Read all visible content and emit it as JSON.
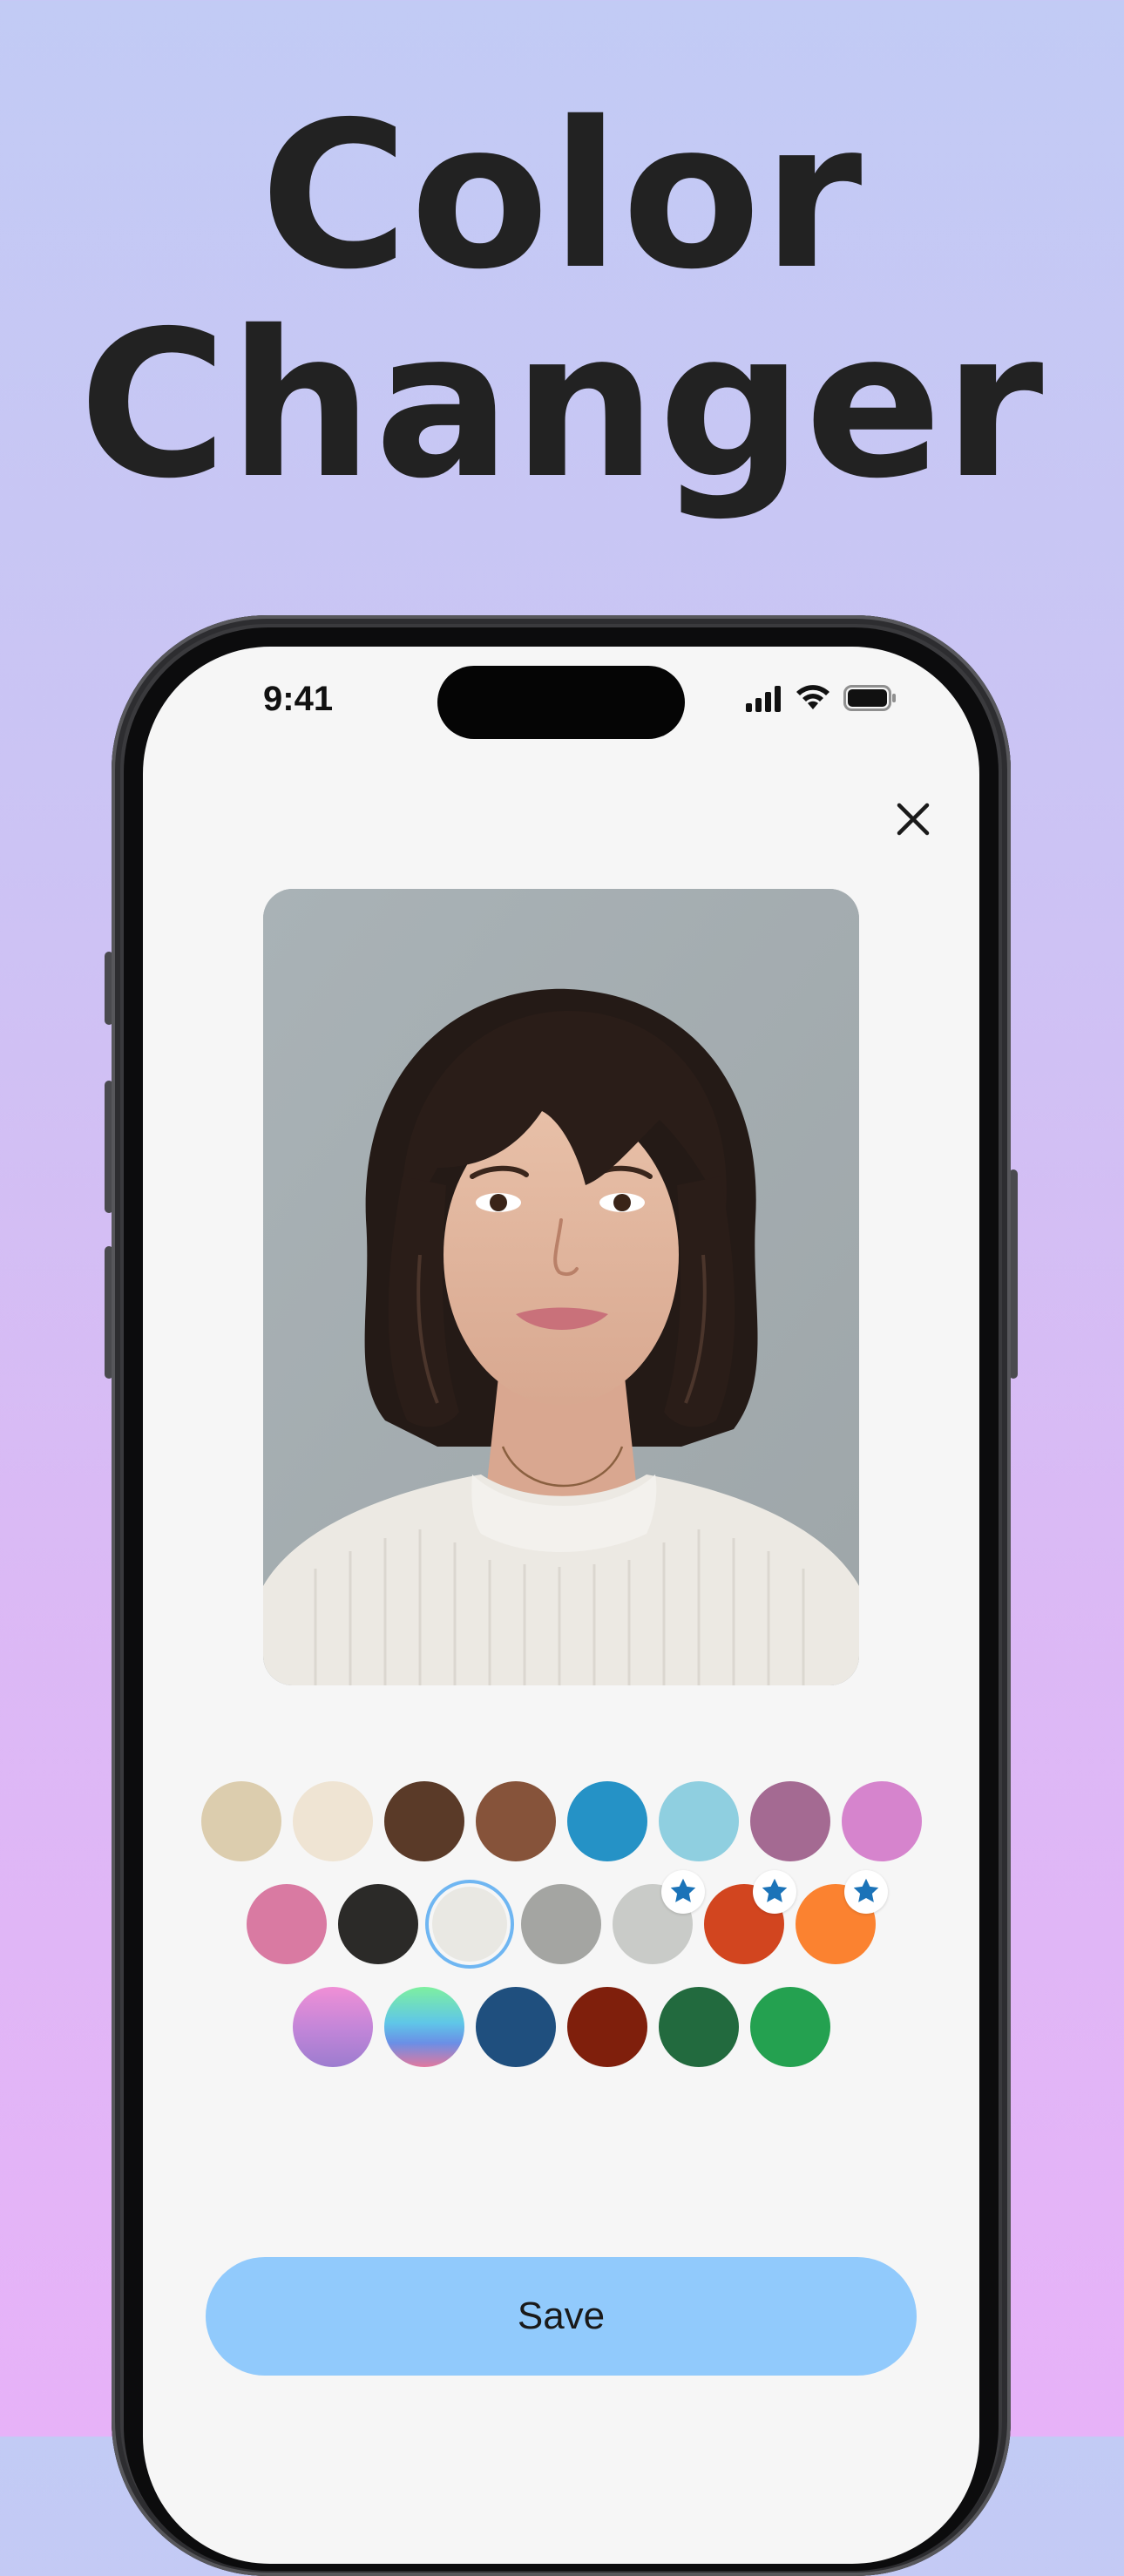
{
  "headline": {
    "line1": "Color",
    "line2": "Changer"
  },
  "status_bar": {
    "time": "9:41",
    "icons": [
      "cellular-signal-icon",
      "wifi-icon",
      "battery-icon"
    ]
  },
  "toolbar": {
    "close_icon": "close-icon"
  },
  "photo": {
    "description_icon": "portrait-photo"
  },
  "swatches": {
    "selected_index": 10,
    "items": [
      {
        "color": "#dccdae",
        "premium": false
      },
      {
        "color": "#efe4d3",
        "premium": false
      },
      {
        "color": "#5a3a28",
        "premium": false
      },
      {
        "color": "#86533a",
        "premium": false
      },
      {
        "color": "#2592c6",
        "premium": false
      },
      {
        "color": "#8fcfe0",
        "premium": false
      },
      {
        "color": "#a46a92",
        "premium": false
      },
      {
        "color": "#d684cd",
        "premium": false
      },
      {
        "color": "#d97aa2",
        "premium": false
      },
      {
        "color": "#2b2a28",
        "premium": false
      },
      {
        "color": "#e9e8e3",
        "premium": false
      },
      {
        "color": "#a4a5a2",
        "premium": false
      },
      {
        "color": "#c9cbc8",
        "premium": true
      },
      {
        "color": "#d2451f",
        "premium": true
      },
      {
        "color": "#fb8230",
        "premium": true
      },
      {
        "color": "gradient-pink-purple",
        "premium": false
      },
      {
        "color": "gradient-green-blue-pink",
        "premium": false
      },
      {
        "color": "#1f4f7e",
        "premium": false
      },
      {
        "color": "#7f1f0c",
        "premium": false
      },
      {
        "color": "#226a3e",
        "premium": false
      },
      {
        "color": "#24a150",
        "premium": false
      }
    ]
  },
  "save_button": {
    "label": "Save"
  },
  "colors": {
    "accent": "#91cafc",
    "premium_star": "#1b73b8",
    "selected_ring": "#6fb6f2"
  }
}
